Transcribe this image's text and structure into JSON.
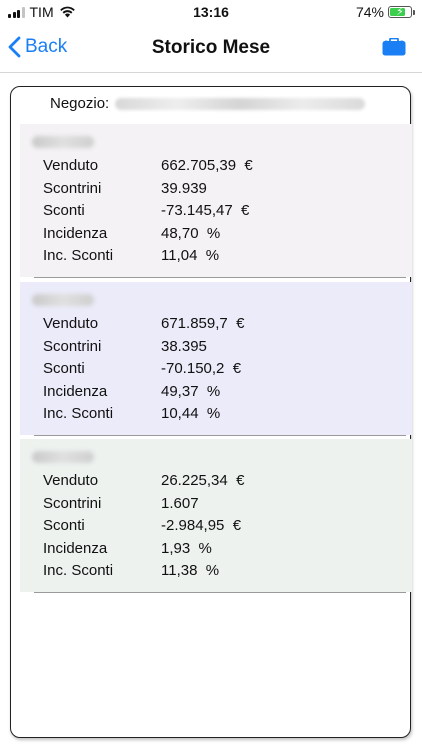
{
  "status_bar": {
    "carrier": "TIM",
    "time": "13:16",
    "battery": "74%",
    "battery_level": 0.74
  },
  "nav": {
    "back_label": "Back",
    "title": "Storico Mese"
  },
  "card": {
    "negozio_label": "Negozio:",
    "sections": [
      {
        "bg": "#f4f2f4",
        "rows": [
          {
            "label": "Venduto",
            "value": "662.705,39  €"
          },
          {
            "label": "Scontrini",
            "value": "39.939"
          },
          {
            "label": "Sconti",
            "value": "-73.145,47  €"
          },
          {
            "label": "Incidenza",
            "value": "48,70  %"
          },
          {
            "label": "Inc. Sconti",
            "value": "11,04  %"
          }
        ]
      },
      {
        "bg": "#ebebfa",
        "rows": [
          {
            "label": "Venduto",
            "value": "671.859,7  €"
          },
          {
            "label": "Scontrini",
            "value": "38.395"
          },
          {
            "label": "Sconti",
            "value": "-70.150,2  €"
          },
          {
            "label": "Incidenza",
            "value": "49,37  %"
          },
          {
            "label": "Inc. Sconti",
            "value": "10,44  %"
          }
        ]
      },
      {
        "bg": "#edf2ef",
        "rows": [
          {
            "label": "Venduto",
            "value": "26.225,34  €"
          },
          {
            "label": "Scontrini",
            "value": "1.607"
          },
          {
            "label": "Sconti",
            "value": "-2.984,95  €"
          },
          {
            "label": "Incidenza",
            "value": "1,93  %"
          },
          {
            "label": "Inc. Sconti",
            "value": "11,38  %"
          }
        ]
      }
    ]
  }
}
